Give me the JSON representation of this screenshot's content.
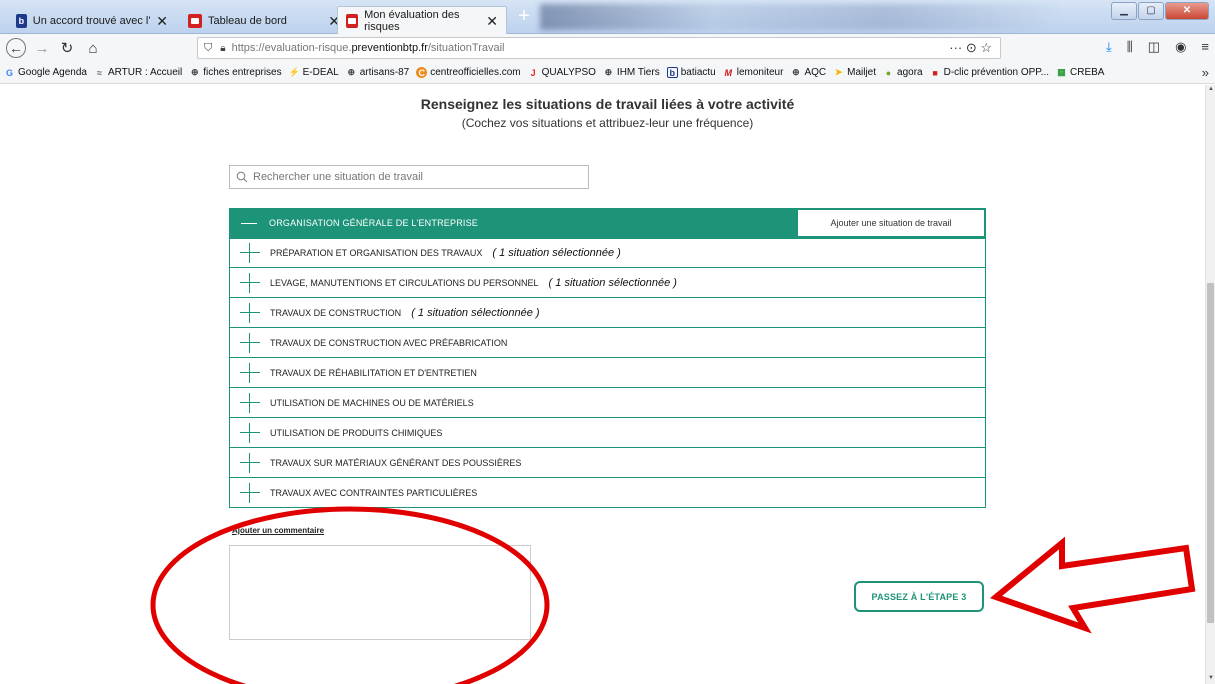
{
  "browser": {
    "tabs": [
      {
        "label": "Un accord trouvé avec l'Etat po",
        "favicon": "b"
      },
      {
        "label": "Tableau de bord",
        "favicon": ""
      },
      {
        "label": "Mon évaluation des risques",
        "favicon": ""
      }
    ],
    "url": {
      "prefix": "https://evaluation-risque.",
      "domain": "preventionbtp.fr",
      "path": "/situationTravail"
    },
    "url_actions": "··· ⊙ ☆",
    "bookmarks": [
      {
        "label": "Google Agenda",
        "icon": "G"
      },
      {
        "label": "ARTUR : Accueil",
        "icon": "≈"
      },
      {
        "label": "fiches entreprises",
        "icon": "⊕"
      },
      {
        "label": "E-DEAL",
        "icon": "⚡"
      },
      {
        "label": "artisans-87",
        "icon": "⊕"
      },
      {
        "label": "centreofficielles.com",
        "icon": "C"
      },
      {
        "label": "QUALYPSO",
        "icon": "J"
      },
      {
        "label": "IHM Tiers",
        "icon": "⊕"
      },
      {
        "label": "batiactu",
        "icon": "b"
      },
      {
        "label": "lemoniteur",
        "icon": "M"
      },
      {
        "label": "AQC",
        "icon": "⊕"
      },
      {
        "label": "Mailjet",
        "icon": "➤"
      },
      {
        "label": "agora",
        "icon": "●"
      },
      {
        "label": "D-clic prévention OPP...",
        "icon": "■"
      },
      {
        "label": "CREBA",
        "icon": "▦"
      }
    ]
  },
  "page": {
    "title": "Renseignez les situations de travail liées à votre activité",
    "subtitle": "(Cochez vos situations et attribuez-leur une fréquence)",
    "search_placeholder": "Rechercher une situation de travail",
    "category_header": {
      "label": "ORGANISATION GÉNÉRALE DE L'ENTREPRISE",
      "add_button": "Ajouter une situation de travail"
    },
    "categories": [
      {
        "label": "PRÉPARATION ET ORGANISATION DES TRAVAUX",
        "selected": "( 1 situation sélectionnée )"
      },
      {
        "label": "LEVAGE, MANUTENTIONS ET CIRCULATIONS DU PERSONNEL",
        "selected": "( 1 situation sélectionnée )"
      },
      {
        "label": "TRAVAUX DE CONSTRUCTION",
        "selected": "( 1 situation sélectionnée )"
      },
      {
        "label": "TRAVAUX DE CONSTRUCTION AVEC PRÉFABRICATION",
        "selected": ""
      },
      {
        "label": "TRAVAUX DE RÉHABILITATION ET D'ENTRETIEN",
        "selected": ""
      },
      {
        "label": "UTILISATION DE MACHINES OU DE MATÉRIELS",
        "selected": ""
      },
      {
        "label": "UTILISATION DE PRODUITS CHIMIQUES",
        "selected": ""
      },
      {
        "label": "TRAVAUX SUR MATÉRIAUX GÉNÉRANT DES POUSSIÈRES",
        "selected": ""
      },
      {
        "label": "TRAVAUX AVEC CONTRAINTES PARTICULIÈRES",
        "selected": ""
      }
    ],
    "comment_link": "Ajouter un commentaire",
    "comment_value": "",
    "next_button": "PASSEZ À L'ÉTAPE 3"
  },
  "colors": {
    "accent": "#1d9377",
    "annotation": "#e00000"
  }
}
